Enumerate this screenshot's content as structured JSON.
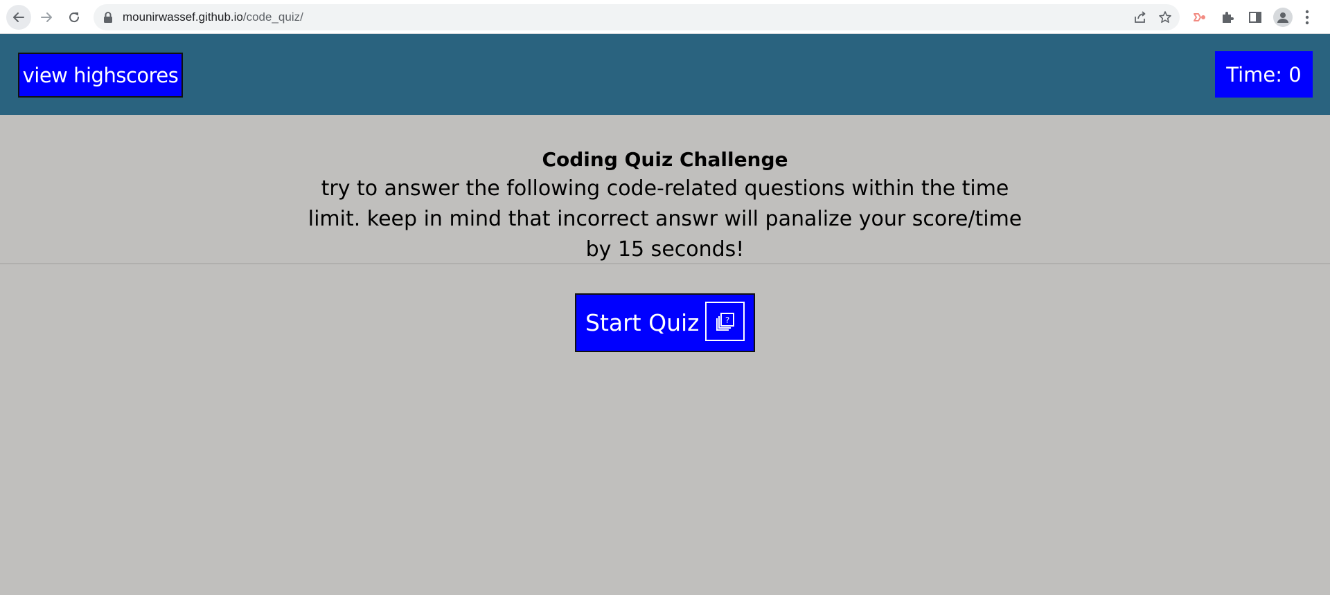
{
  "browser": {
    "url_domain": "mounirwassef.github.io",
    "url_path": "/code_quiz/"
  },
  "header": {
    "highscores_label": "view highscores",
    "timer_label": "Time: 0"
  },
  "intro": {
    "title": "Coding Quiz Challenge",
    "description": "try to answer the following code-related questions within the time limit. keep in mind that incorrect answr will panalize your score/time by 15 seconds!"
  },
  "start": {
    "label": "Start Quiz",
    "icon": "quiz-question-icon"
  },
  "colors": {
    "header_bg": "#2a637f",
    "page_bg": "#c0bfbd",
    "button_bg": "#0000ff",
    "button_text": "#ffffff"
  }
}
